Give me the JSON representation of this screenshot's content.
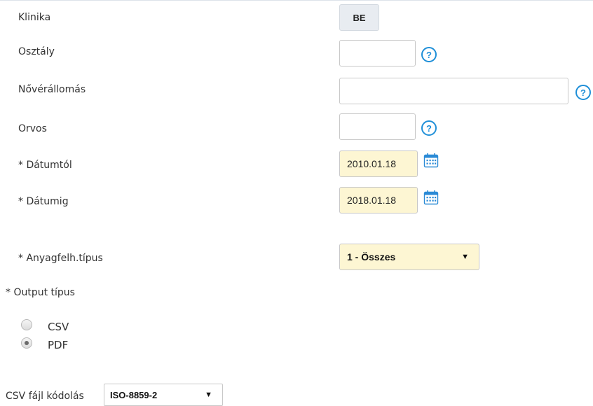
{
  "fields": {
    "klinika": {
      "label": "Klinika",
      "value": "BE"
    },
    "osztaly": {
      "label": "Osztály",
      "value": ""
    },
    "noverallomas": {
      "label": "Nővérállomás",
      "value": ""
    },
    "orvos": {
      "label": "Orvos",
      "value": ""
    },
    "datumtol": {
      "label": "* Dátumtól",
      "value": "2010.01.18"
    },
    "datumig": {
      "label": "* Dátumig",
      "value": "2018.01.18"
    },
    "anyagfelh": {
      "label": "* Anyagfelh.típus",
      "value": "1 - Összes"
    }
  },
  "output": {
    "label": "* Output típus",
    "options": [
      {
        "label": "CSV",
        "selected": false
      },
      {
        "label": "PDF",
        "selected": true
      }
    ]
  },
  "csv_encoding": {
    "label": "CSV fájl kódolás",
    "value": "ISO-8859-2"
  },
  "icons": {
    "help": "help-circle-icon",
    "calendar": "calendar-icon",
    "dropdown": "chevron-down-icon"
  },
  "colors": {
    "help_icon": "#1f8fd8",
    "required_field_bg": "#fdf6d3",
    "readonly_bg": "#e8ecf1"
  }
}
